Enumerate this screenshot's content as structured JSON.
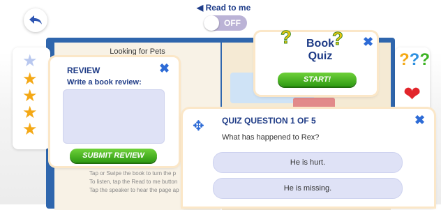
{
  "header": {
    "back_icon": "undo-arrow-icon",
    "read_to_me_label": "Read to me",
    "speaker_icon": "speaker-icon",
    "toggle_state": "OFF"
  },
  "book": {
    "title": "Looking for Pets",
    "instructions": [
      "Tap or Swipe the book to turn the p",
      "To listen, tap the Read to me button",
      "Tap the speaker to hear the page ap"
    ]
  },
  "left_rail": {
    "stars": [
      "star-outline-icon",
      "star-icon",
      "star-icon",
      "star-icon",
      "star-icon"
    ]
  },
  "right_rail": {
    "quiz_icon": "question-marks-icon",
    "favorite_icon": "heart-icon"
  },
  "review_popup": {
    "title": "REVIEW",
    "subtitle": "Write a book review:",
    "input_value": "",
    "submit_label": "SUBMIT REVIEW"
  },
  "book_quiz_popup": {
    "title_line1": "Book",
    "title_line2": "Quiz",
    "start_label": "START!"
  },
  "quiz_question_popup": {
    "title": "QUIZ QUESTION 1 OF 5",
    "question": "What has happened to Rex?",
    "answers": [
      "He is hurt.",
      "He is missing."
    ]
  },
  "colors": {
    "accent_blue": "#1e3b86",
    "button_green": "#3cb323",
    "frame_blue": "#2f66ad",
    "star_gold": "#f4a815",
    "heart_red": "#e2252b"
  }
}
